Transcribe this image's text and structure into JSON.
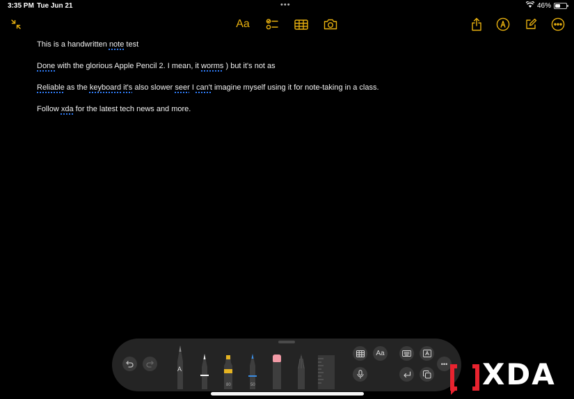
{
  "status_bar": {
    "time": "3:35 PM",
    "date": "Tue Jun 21",
    "battery_text": "46%",
    "battery_level": 0.46,
    "icons": [
      "wifi-icon",
      "battery-icon"
    ]
  },
  "toolbar": {
    "font_button_label": "Aa",
    "accent_color": "#e9b10f",
    "left_icons": [
      "collapse-icon"
    ],
    "center_icons": [
      "format-text",
      "checklist-icon",
      "table-icon",
      "camera-icon"
    ],
    "right_icons": [
      "share-icon",
      "markup-pencil-icon",
      "compose-icon",
      "more-icon"
    ]
  },
  "note": {
    "lines": [
      [
        {
          "t": "This is a handwritten "
        },
        {
          "t": "note",
          "u": true
        },
        {
          "t": " test"
        }
      ],
      [
        {
          "t": "Done",
          "u": true
        },
        {
          "t": " with the glorious Apple Pencil 2. I mean, it "
        },
        {
          "t": "worms",
          "u": true
        },
        {
          "t": " ) but it's not as"
        }
      ],
      [
        {
          "t": "Reliable",
          "u": true
        },
        {
          "t": " as the "
        },
        {
          "t": "keyboard",
          "u": true
        },
        {
          "t": " "
        },
        {
          "t": "it's",
          "u": true
        },
        {
          "t": " also slower "
        },
        {
          "t": "seer",
          "u": true
        },
        {
          "t": " I "
        },
        {
          "t": "can't",
          "u": true
        },
        {
          "t": " imagine myself using it for note-taking in a class."
        }
      ],
      [
        {
          "t": "Follow "
        },
        {
          "t": "xda",
          "u": true
        },
        {
          "t": " for the latest tech news and more."
        }
      ]
    ]
  },
  "tool_palette": {
    "undo_icon": "undo-icon",
    "redo_icon": "redo-icon",
    "tools": [
      {
        "name": "handwriting-tool",
        "label": "A"
      },
      {
        "name": "pen-tool",
        "label": ""
      },
      {
        "name": "highlighter-tool",
        "label": "80"
      },
      {
        "name": "pencil-tool",
        "label": "50"
      },
      {
        "name": "eraser-tool",
        "label": ""
      },
      {
        "name": "lasso-tool",
        "label": ""
      },
      {
        "name": "ruler-tool",
        "label": ""
      }
    ],
    "highlighter_color": "#e6b422",
    "pencil_color": "#3a8ee6",
    "eraser_color": "#f29aa6",
    "scribble_buttons": {
      "table_icon": "table-icon",
      "format_label": "Aa",
      "mic_icon": "microphone-icon",
      "keyboard_icon": "keyboard-icon",
      "text_box_icon": "text-box-icon",
      "return_icon": "return-icon",
      "copy_icon": "copy-icon"
    },
    "more_label": "•••"
  },
  "watermark": {
    "text": "XDA",
    "bracket_color": "#e8232f"
  }
}
